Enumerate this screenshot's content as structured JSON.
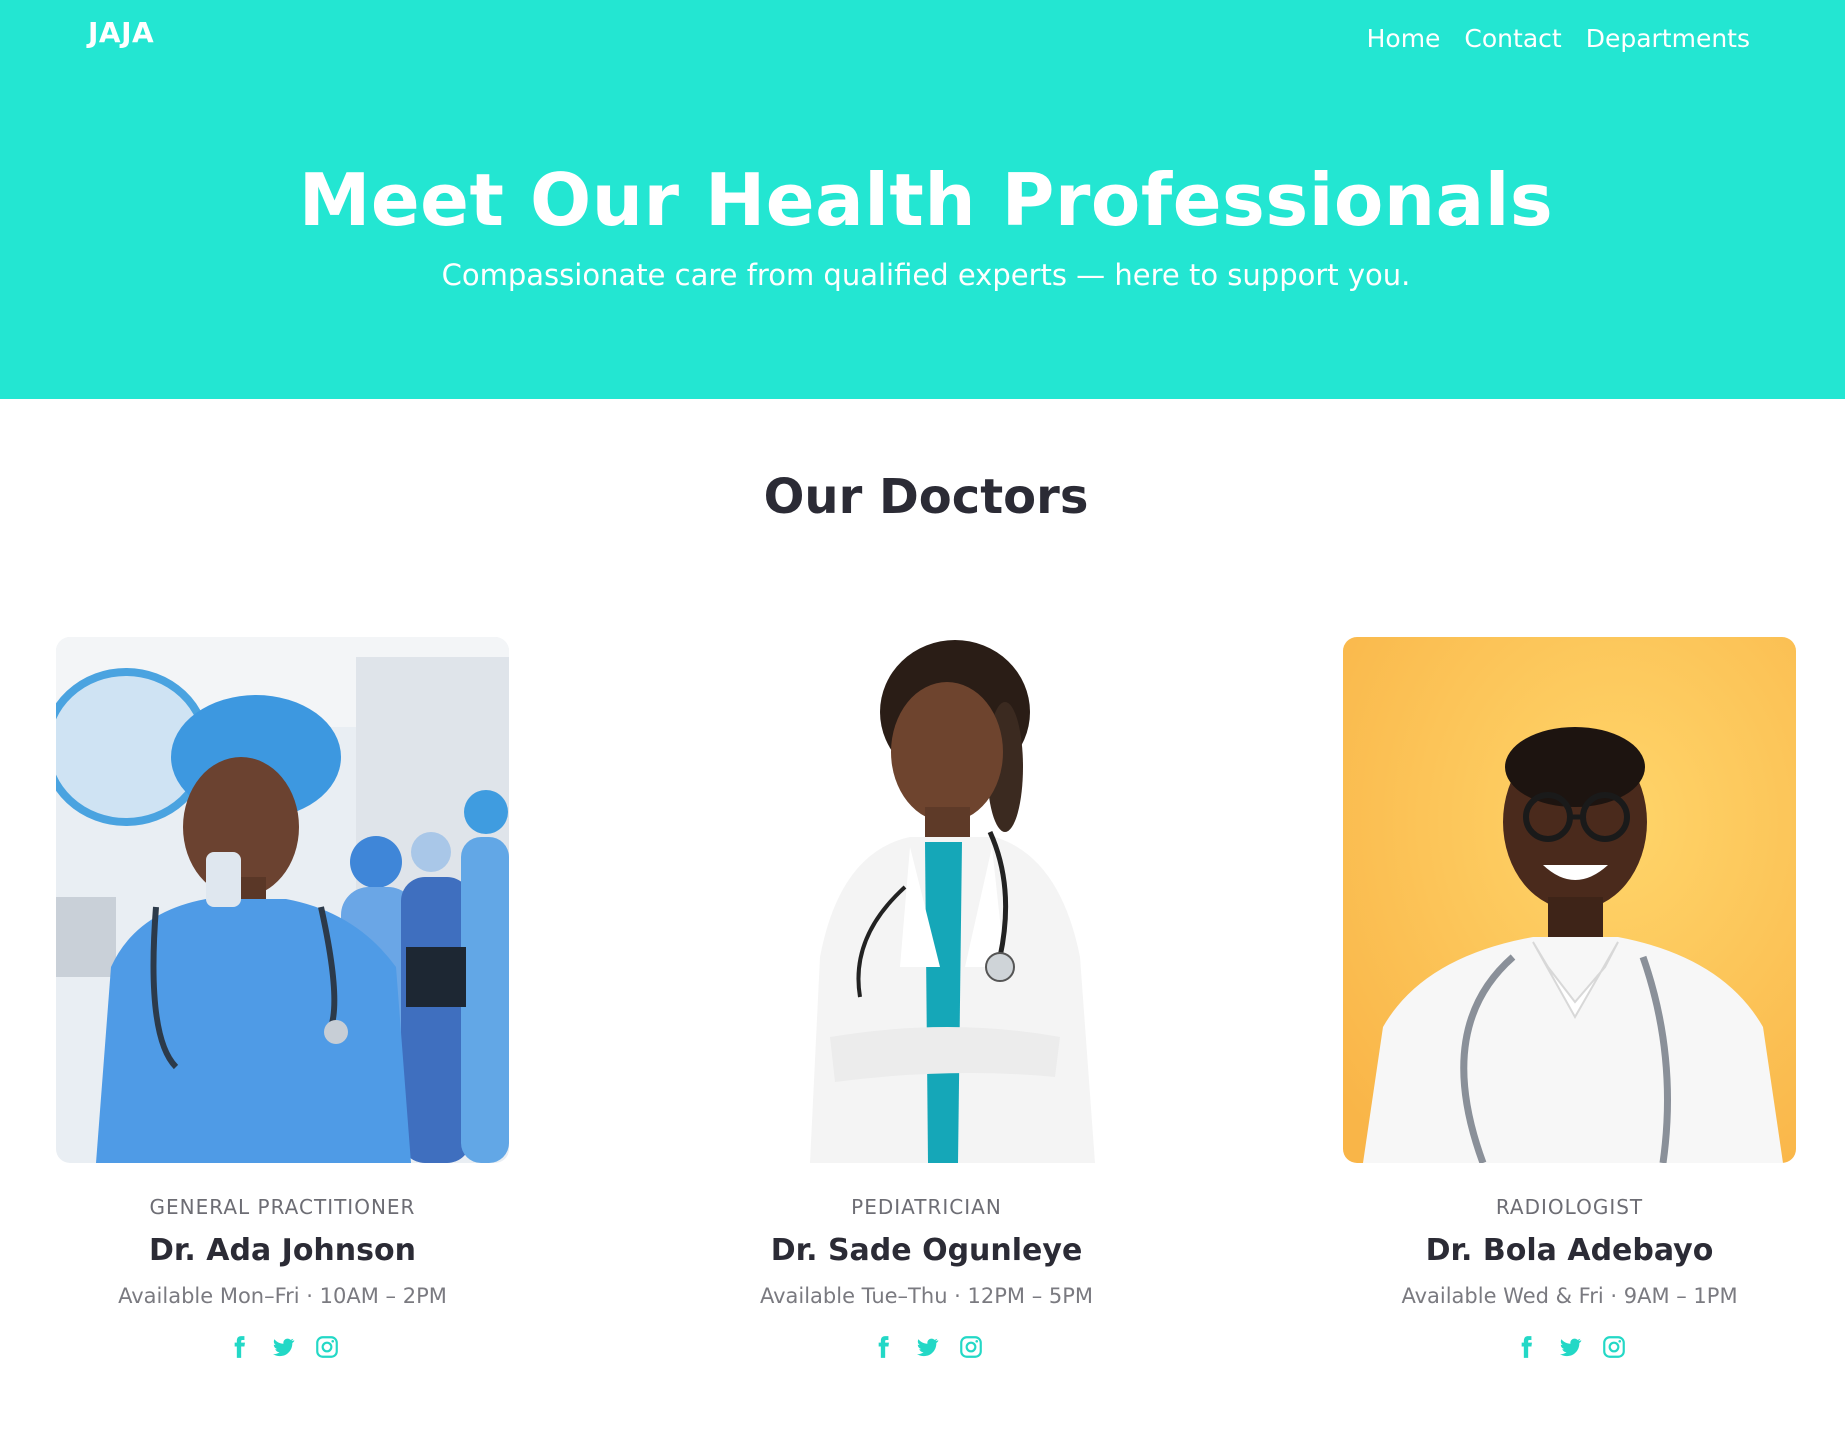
{
  "header": {
    "logo": "JAJA",
    "nav": [
      "Home",
      "Contact",
      "Departments"
    ]
  },
  "hero": {
    "title": "Meet Our Health Professionals",
    "subtitle": "Compassionate care from qualified experts — here to support you."
  },
  "doctors_section": {
    "title": "Our Doctors",
    "doctors": [
      {
        "role": "GENERAL PRACTITIONER",
        "name": "Dr. Ada Johnson",
        "availability": "Available Mon–Fri · 10AM – 2PM"
      },
      {
        "role": "PEDIATRICIAN",
        "name": "Dr. Sade Ogunleye",
        "availability": "Available Tue–Thu · 12PM – 5PM"
      },
      {
        "role": "RADIOLOGIST",
        "name": "Dr. Bola Adebayo",
        "availability": "Available Wed & Fri · 9AM – 1PM"
      }
    ]
  },
  "colors": {
    "brand": "#23e6d2",
    "text_dark": "#2b2b35",
    "text_muted": "#7a7a80"
  },
  "icons": [
    "facebook-icon",
    "twitter-icon",
    "instagram-icon"
  ]
}
